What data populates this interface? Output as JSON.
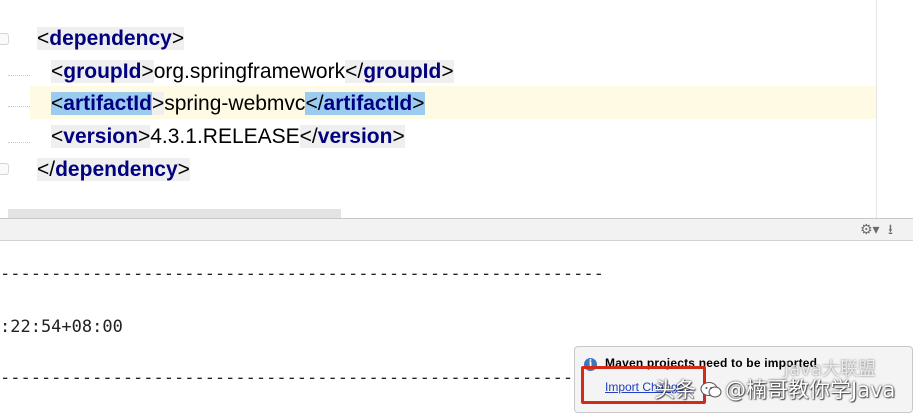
{
  "editor": {
    "lines": [
      {
        "open_bracket": "<",
        "tag": "dependency",
        "close_bracket": ">"
      },
      {
        "open_bracket": "<",
        "tag": "groupId",
        "close_bracket": ">",
        "text": "org.springframework",
        "end_open": "</",
        "end_tag": "groupId",
        "end_close": ">"
      },
      {
        "open_bracket": "<",
        "tag": "artifactId",
        "close_bracket": ">",
        "text": "spring-webmvc",
        "end_open": "</",
        "end_tag": "artifactId",
        "end_close": ">"
      },
      {
        "open_bracket": "<",
        "tag": "version",
        "close_bracket": ">",
        "text": "4.3.1.RELEASE",
        "end_open": "</",
        "end_tag": "version",
        "end_close": ">"
      },
      {
        "open_bracket": "</",
        "tag": "dependency",
        "close_bracket": ">"
      }
    ]
  },
  "tool_header": {
    "settings_icon": "gear-icon",
    "settings_glyph": "⚙▾",
    "pin_icon": "pin-icon",
    "pin_glyph": "⭳"
  },
  "console": {
    "lines": [
      "-----------------------------------------------------------",
      ":22:54+08:00",
      "-----------------------------------------------------------"
    ]
  },
  "notification": {
    "icon": "info-icon",
    "icon_glyph": "i",
    "title": "Maven projects need to be imported",
    "link": "Import Changes"
  },
  "watermark": {
    "line1": "Java大联盟",
    "source": "头条",
    "author": "@楠哥教你学Java"
  },
  "colors": {
    "tag": "#000080",
    "highlight": "#9ccbf0",
    "caret_row": "#fffae3",
    "red_box": "#d42a1c",
    "link": "#2040c0"
  }
}
